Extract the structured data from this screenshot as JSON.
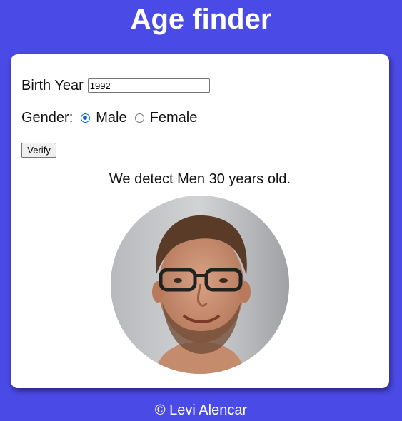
{
  "app": {
    "title": "Age finder"
  },
  "form": {
    "birth_year_label": "Birth Year",
    "birth_year_value": "1992",
    "gender_label": "Gender:",
    "gender_options": [
      {
        "label": "Male",
        "selected": true
      },
      {
        "label": "Female",
        "selected": false
      }
    ],
    "verify_label": "Verify"
  },
  "result": {
    "text": "We detect Men 30 years old."
  },
  "footer": {
    "text": "© Levi Alencar"
  },
  "colors": {
    "background": "#4a4ae6",
    "card": "#ffffff",
    "radio_accent": "#0b6ad9"
  }
}
